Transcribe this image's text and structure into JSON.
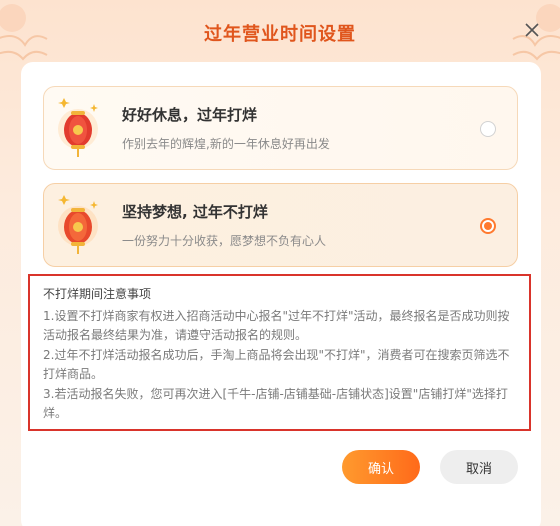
{
  "dialog": {
    "title": "过年营业时间设置"
  },
  "options": [
    {
      "title": "好好休息，过年打烊",
      "subtitle": "作别去年的辉煌,新的一年休息好再出发",
      "selected": false
    },
    {
      "title": "坚持梦想, 过年不打烊",
      "subtitle": "一份努力十分收获，愿梦想不负有心人",
      "selected": true
    }
  ],
  "notice": {
    "title": "不打烊期间注意事项",
    "items": [
      "1.设置不打烊商家有权进入招商活动中心报名\"过年不打烊\"活动，最终报名是否成功则按活动报名最终结果为准，请遵守活动报名的规则。",
      "2.过年不打烊活动报名成功后，手淘上商品将会出现\"不打烊\"，消费者可在搜索页筛选不打烊商品。",
      "3.若活动报名失败，您可再次进入[千牛-店铺-店铺基础-店铺状态]设置\"店铺打烊\"选择打烊。"
    ]
  },
  "buttons": {
    "confirm": "确认",
    "cancel": "取消"
  },
  "colors": {
    "accent": "#ff7a2f",
    "title": "#e0561d",
    "notice_border": "#d9342b"
  },
  "icons": {
    "close": "close-icon",
    "lantern": "lantern-icon"
  }
}
